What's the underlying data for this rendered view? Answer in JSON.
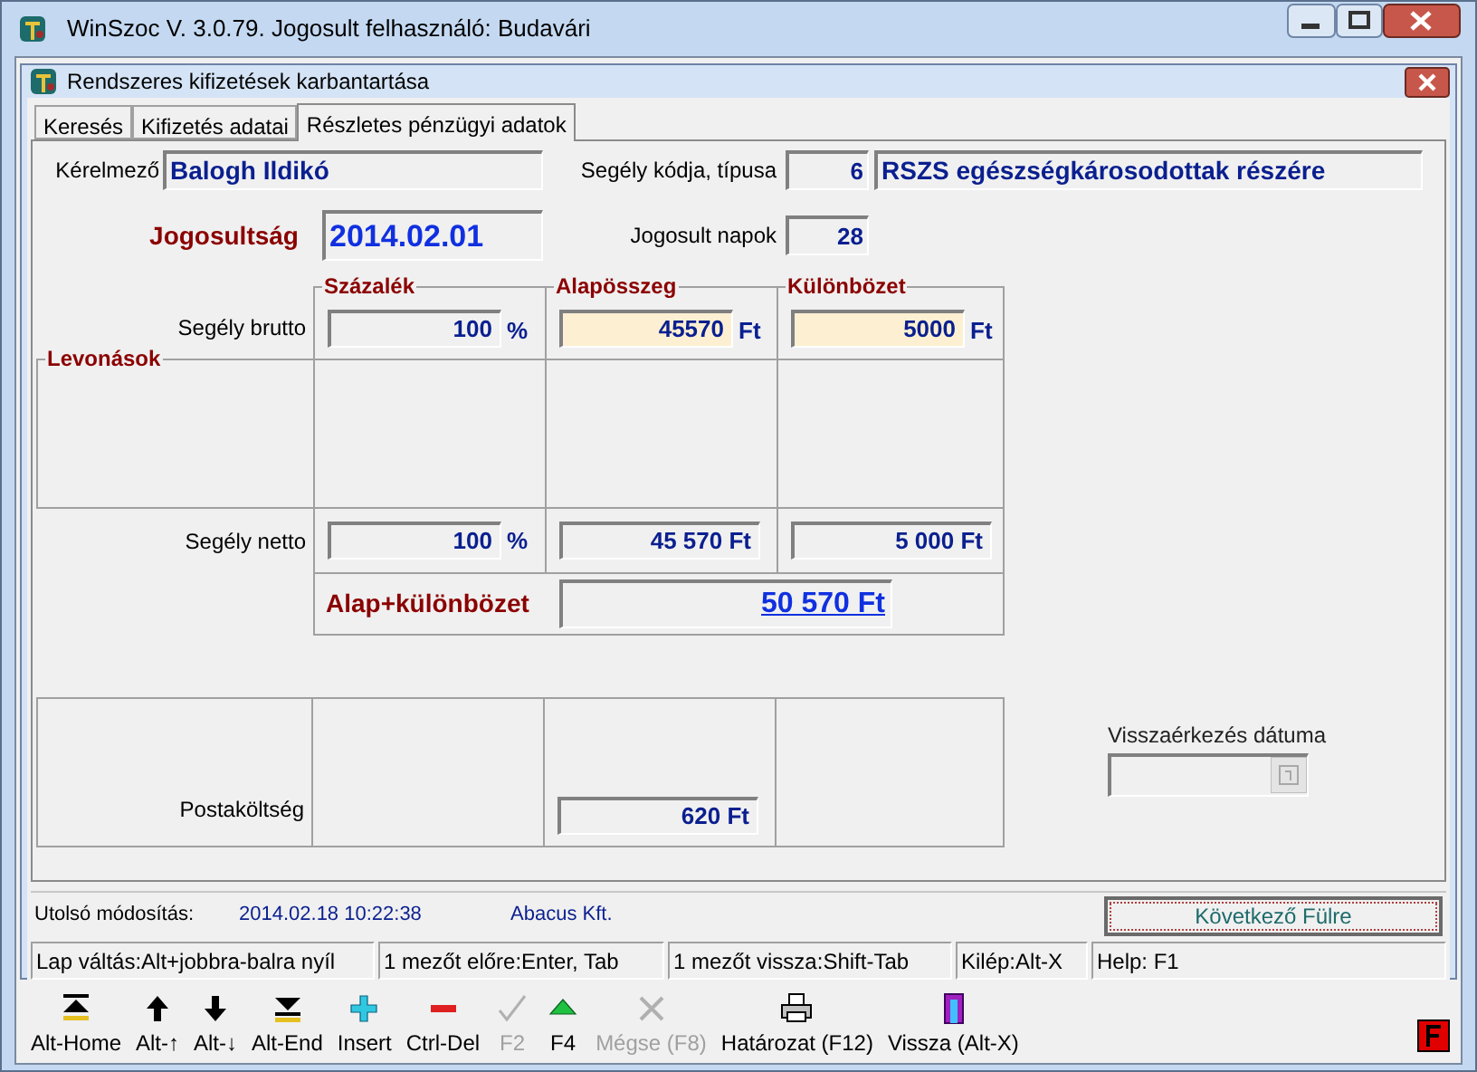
{
  "window": {
    "title": "WinSzoc V. 3.0.79. Jogosult felhasználó: Budavári"
  },
  "child_window": {
    "title": "Rendszeres kifizetések karbantartása"
  },
  "tabs": [
    {
      "label": "Keresés",
      "selected": false
    },
    {
      "label": "Kifizetés adatai",
      "selected": false
    },
    {
      "label": "Részletes pénzügyi adatok",
      "selected": true
    }
  ],
  "applicant": {
    "label": "Kérelmező",
    "value": "Balogh Ildikó"
  },
  "aid_code": {
    "label": "Segély kódja, típusa",
    "code": "6",
    "type": "RSZS egészségkárosodottak részére"
  },
  "entitlement": {
    "label": "Jogosultság",
    "value": "2014.02.01"
  },
  "entitled_days": {
    "label": "Jogosult napok",
    "value": "28"
  },
  "columns": [
    "Százalék",
    "Alapösszeg",
    "Különbözet"
  ],
  "gross": {
    "label": "Segély brutto",
    "cells": [
      {
        "value": "100",
        "unit": "%",
        "editable": false
      },
      {
        "value": "45570",
        "unit": "Ft",
        "editable": true
      },
      {
        "value": "5000",
        "unit": "Ft",
        "editable": true
      }
    ]
  },
  "deductions": {
    "title": "Levonások"
  },
  "net": {
    "label": "Segély netto",
    "cells": [
      {
        "value": "100",
        "unit": "%"
      },
      {
        "value": "45 570 Ft"
      },
      {
        "value": "5 000 Ft"
      }
    ]
  },
  "total": {
    "label": "Alap+különbözet",
    "value": "50 570 Ft"
  },
  "postage": {
    "label": "Postaköltség",
    "value": "620 Ft"
  },
  "return_date": {
    "label": "Visszaérkezés dátuma",
    "disabled": true
  },
  "last_modified": {
    "label": "Utolsó módosítás:",
    "date": "2014.02.18 10:22:38",
    "by": "Abacus Kft."
  },
  "next_tab_button": "Következő Fülre",
  "status_bar": [
    "Lap váltás:Alt+jobbra-balra nyíl",
    "1 mezőt előre:Enter, Tab",
    "1 mezőt vissza:Shift-Tab",
    "Kilép:Alt-X",
    "Help: F1"
  ],
  "toolbar": [
    {
      "kind": "first",
      "label": "Alt-Home",
      "disabled": false
    },
    {
      "kind": "up",
      "label": "Alt-↑",
      "disabled": false
    },
    {
      "kind": "down",
      "label": "Alt-↓",
      "disabled": false
    },
    {
      "kind": "last",
      "label": "Alt-End",
      "disabled": false
    },
    {
      "kind": "insert",
      "label": "Insert",
      "disabled": false
    },
    {
      "kind": "delete",
      "label": "Ctrl-Del",
      "disabled": false
    },
    {
      "kind": "save",
      "label": "F2",
      "disabled": true
    },
    {
      "kind": "edit",
      "label": "F4",
      "disabled": false
    },
    {
      "kind": "cancel",
      "label": "Mégse (F8)",
      "disabled": true
    },
    {
      "kind": "print",
      "label": "Határozat (F12)",
      "disabled": false
    },
    {
      "kind": "exit",
      "label": "Vissza (Alt-X)",
      "disabled": false
    }
  ]
}
